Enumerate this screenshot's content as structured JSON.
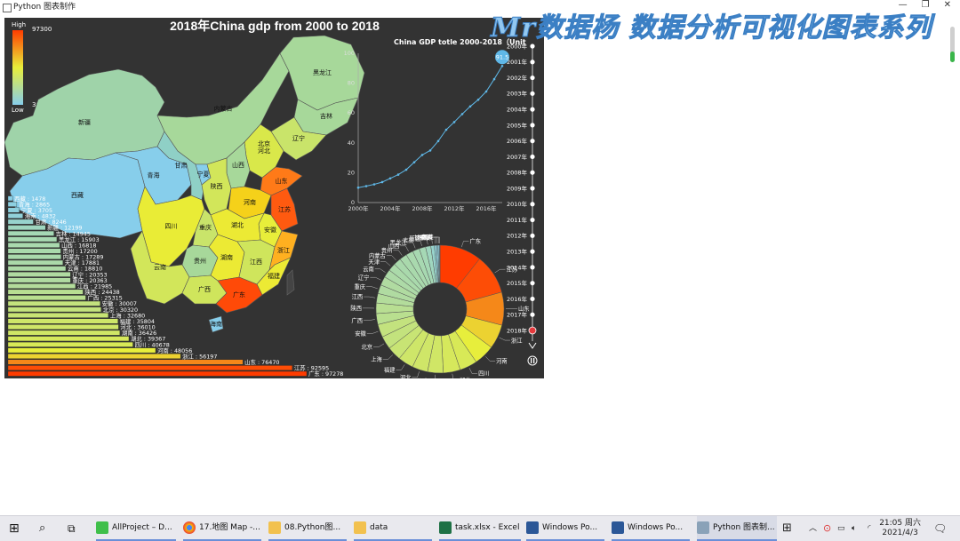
{
  "window": {
    "title": "Python 图表制作"
  },
  "overlay_title": "Mr数据杨 数据分析可视化图表系列",
  "chart_data": [
    {
      "type": "map",
      "title": "2018年China gdp from 2000 to 2018",
      "visual_map": {
        "high_label": "High",
        "low_label": "Low",
        "max": "97300",
        "min": "30"
      },
      "regions": [
        "新疆",
        "西藏",
        "青海",
        "甘肃",
        "宁夏",
        "内蒙古",
        "黑龙江",
        "吉林",
        "辽宁",
        "北京",
        "河北",
        "山西",
        "陕西",
        "山东",
        "河南",
        "江苏",
        "安徽",
        "湖北",
        "四川",
        "重庆",
        "贵州",
        "湖南",
        "江西",
        "浙江",
        "福建",
        "广东",
        "广西",
        "云南",
        "海南"
      ]
    },
    {
      "type": "bar",
      "orientation": "horizontal",
      "categories": [
        "西藏",
        "青海",
        "宁夏",
        "海南",
        "甘肃",
        "新疆",
        "吉林",
        "黑龙江",
        "山西",
        "贵州",
        "内蒙古",
        "天津",
        "云南",
        "辽宁",
        "重庆",
        "江西",
        "陕西",
        "广西",
        "安徽",
        "北京",
        "上海",
        "福建",
        "河北",
        "湖南",
        "湖北",
        "四川",
        "河南",
        "浙江",
        "山东",
        "江苏",
        "广东"
      ],
      "values": [
        1478,
        2865,
        3705,
        4832,
        8246,
        12199,
        14945,
        15903,
        16818,
        17200,
        17289,
        17881,
        18810,
        20353,
        20363,
        21985,
        24438,
        25315,
        30007,
        30320,
        32680,
        35804,
        36010,
        36426,
        39367,
        40678,
        48056,
        56197,
        76470,
        92595,
        97278
      ],
      "labels": [
        "西藏 : 1478",
        "青海 : 2865",
        "宁夏 : 3705",
        "海南 : 4832",
        "甘肃 : 8246",
        "新疆 : 12199",
        "吉林 : 14945",
        "黑龙江 : 15903",
        "山西 : 16818",
        "贵州 : 17200",
        "内蒙古 : 17289",
        "天津 : 17881",
        "云南 : 18810",
        "辽宁 : 20353",
        "重庆 : 20363",
        "江西 : 21985",
        "陕西 : 24438",
        "广西 : 25315",
        "安徽 : 30007",
        "北京 : 30320",
        "上海 : 32680",
        "福建 : 35804",
        "河北 : 36010",
        "湖南 : 36426",
        "湖北 : 39367",
        "四川 : 40678",
        "河南 : 48056",
        "浙江 : 56197",
        "山东 : 76470",
        "江苏 : 92595",
        "广东 : 97278"
      ]
    },
    {
      "type": "line",
      "title": "China GDP totle 2000-2018（Unit",
      "x": [
        2000,
        2001,
        2002,
        2003,
        2004,
        2005,
        2006,
        2007,
        2008,
        2009,
        2010,
        2011,
        2012,
        2013,
        2014,
        2015,
        2016,
        2017,
        2018
      ],
      "y": [
        10.0,
        11.0,
        12.2,
        13.7,
        16.2,
        18.7,
        22.0,
        27.0,
        31.9,
        34.9,
        41.2,
        48.8,
        53.9,
        59.3,
        64.4,
        68.9,
        74.4,
        82.7,
        91.5
      ],
      "xticks": [
        "2000年",
        "2004年",
        "2008年",
        "2012年",
        "2016年"
      ],
      "yticks": [
        "0",
        "20",
        "40",
        "60",
        "80",
        "100"
      ],
      "ylim": [
        0,
        100
      ],
      "last_label": "91.5"
    },
    {
      "type": "pie",
      "variant": "ring",
      "categories": [
        "广东",
        "江苏",
        "山东",
        "浙江",
        "河南",
        "四川",
        "湖北",
        "湖南",
        "河北",
        "福建",
        "上海",
        "北京",
        "安徽",
        "广西",
        "陕西",
        "江西",
        "重庆",
        "辽宁",
        "云南",
        "天津",
        "内蒙古",
        "贵州",
        "山西",
        "黑龙江",
        "吉林",
        "新疆",
        "甘肃",
        "海南",
        "宁夏",
        "青海",
        "西藏"
      ],
      "values": [
        97278,
        92595,
        76470,
        56197,
        48056,
        40678,
        39367,
        36426,
        36010,
        35804,
        32680,
        30320,
        30007,
        25315,
        24438,
        21985,
        20363,
        20353,
        18810,
        17881,
        17289,
        17200,
        16818,
        15903,
        14945,
        12199,
        8246,
        4832,
        3705,
        2865,
        1478
      ]
    }
  ],
  "timeline": {
    "years": [
      "2000年",
      "2001年",
      "2002年",
      "2003年",
      "2004年",
      "2005年",
      "2006年",
      "2007年",
      "2008年",
      "2009年",
      "2010年",
      "2011年",
      "2012年",
      "2013年",
      "2014年",
      "2015年",
      "2016年",
      "2017年",
      "2018年"
    ],
    "current": "2018年"
  },
  "taskbar": {
    "items": [
      "AllProject – D...",
      "17.地图 Map -...",
      "08.Python图...",
      "data",
      "task.xlsx - Excel",
      "Windows Po...",
      "Windows Po...",
      "Python 图表制..."
    ],
    "time": "21:05 周六",
    "date": "2021/4/3"
  },
  "colors": {
    "background": "#333333",
    "low": "#87ceeb",
    "mid": "#e8ee3a",
    "high": "#ff3c00"
  }
}
